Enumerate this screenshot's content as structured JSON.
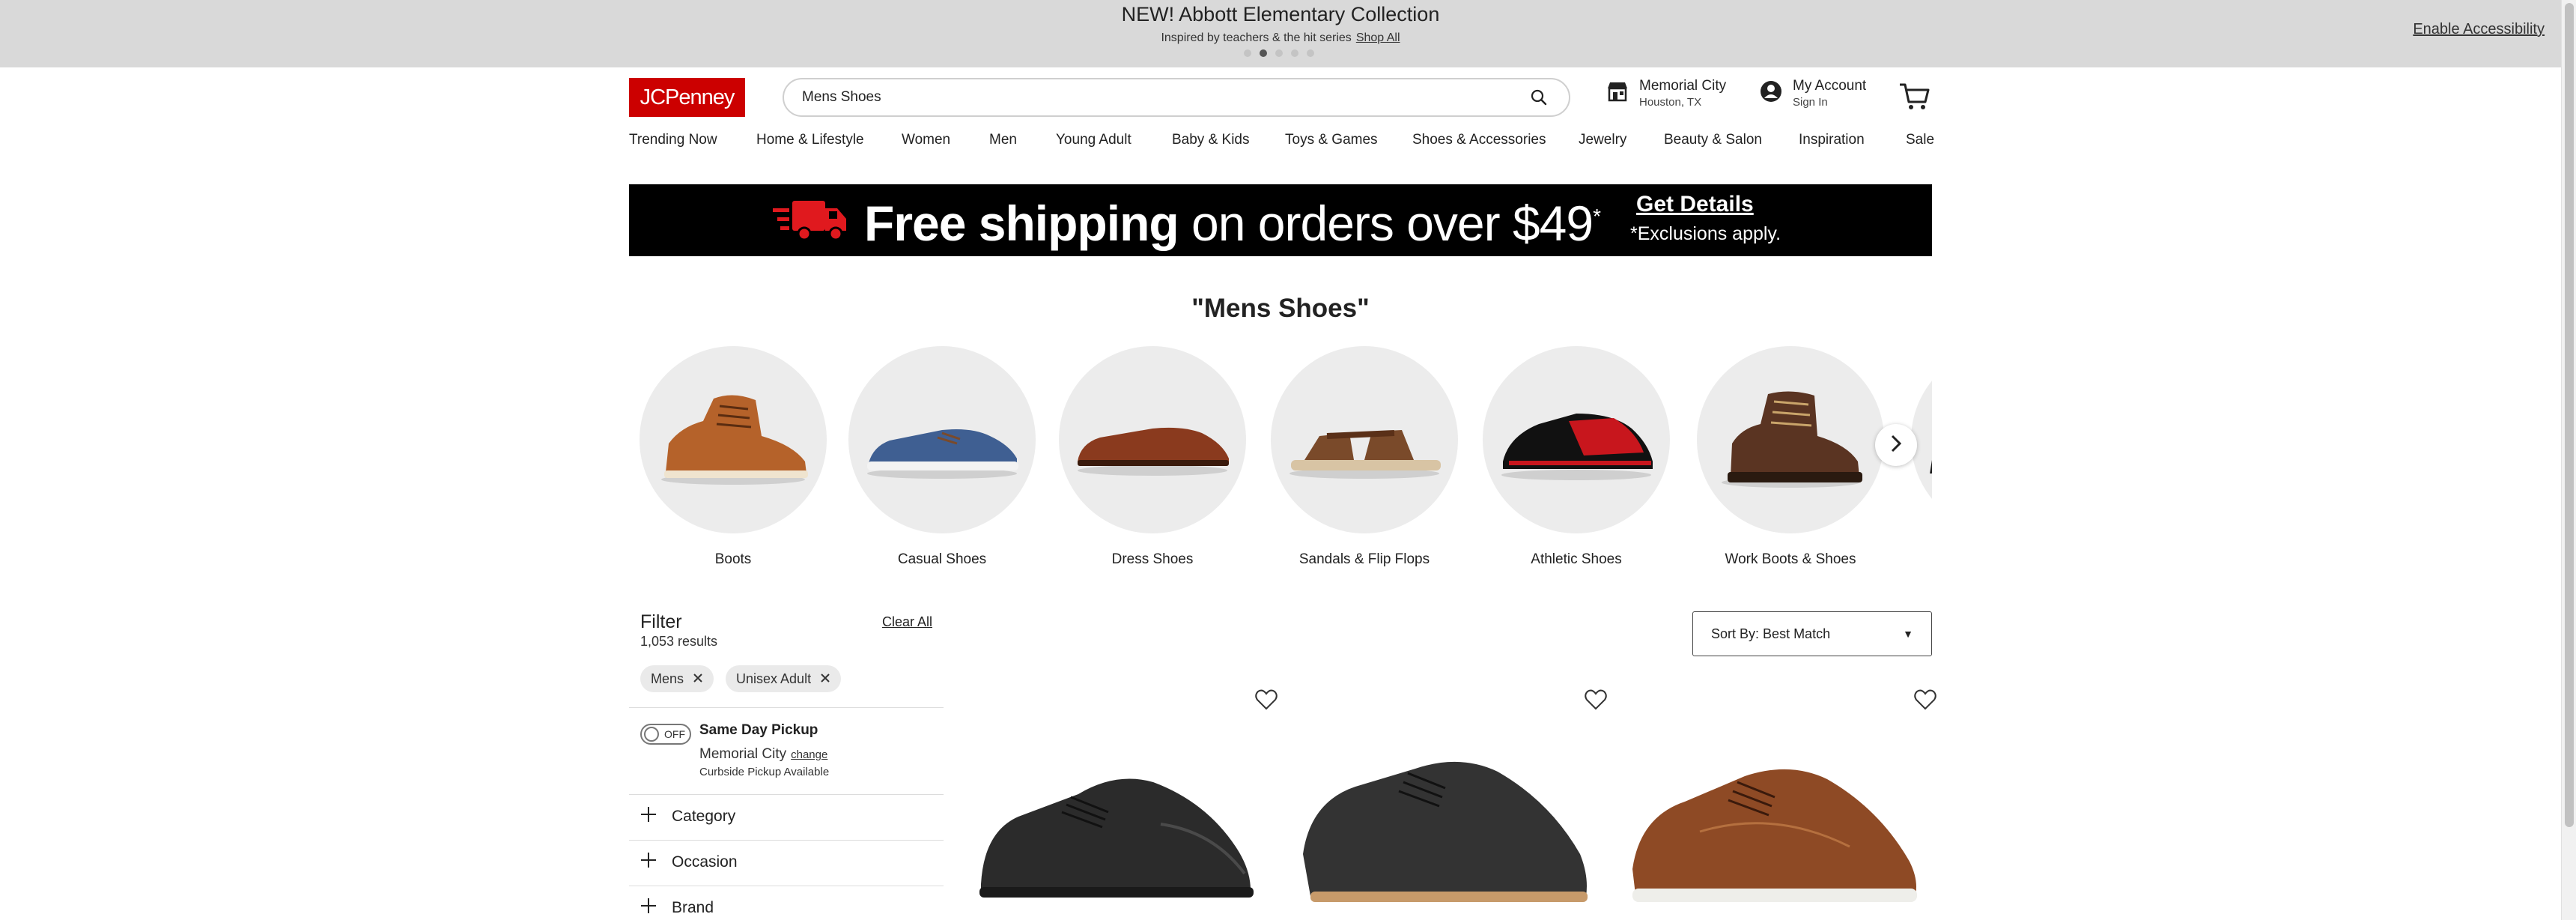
{
  "promo": {
    "title": "NEW! Abbott Elementary Collection",
    "subtitle": "Inspired by teachers & the hit series",
    "link": "Shop All",
    "slide_count": 5,
    "active_slide": 2,
    "accessibility_link": "Enable Accessibility"
  },
  "header": {
    "logo": "JCPenney",
    "search_value": "Mens Shoes",
    "store_name": "Memorial City",
    "store_location": "Houston, TX",
    "account_label": "My Account",
    "account_sub": "Sign In"
  },
  "nav": [
    "Trending Now",
    "Home & Lifestyle",
    "Women",
    "Men",
    "Young Adult",
    "Baby & Kids",
    "Toys & Games",
    "Shoes & Accessories",
    "Jewelry",
    "Beauty & Salon",
    "Inspiration",
    "Sale"
  ],
  "banner": {
    "bold": "Free shipping",
    "rest": " on orders over $49",
    "asterisk": "*",
    "cta": "Get Details",
    "note": "*Exclusions apply."
  },
  "results_title": "\"Mens Shoes\"",
  "categories": [
    {
      "label": "Boots",
      "color": "#b5622a"
    },
    {
      "label": "Casual Shoes",
      "color": "#3f5f92"
    },
    {
      "label": "Dress Shoes",
      "color": "#8a3a1e"
    },
    {
      "label": "Sandals & Flip Flops",
      "color": "#7a4a2a"
    },
    {
      "label": "Athletic Shoes",
      "color": "#c8161d"
    },
    {
      "label": "Work Boots & Shoes",
      "color": "#5a3422"
    }
  ],
  "filter": {
    "heading": "Filter",
    "count": "1,053 results",
    "clear_all": "Clear All",
    "chips": [
      "Mens",
      "Unisex Adult"
    ],
    "toggle_label": "OFF",
    "pickup_title": "Same Day Pickup",
    "pickup_store": "Memorial City",
    "change_link": "change",
    "pickup_note": "Curbside Pickup Available",
    "facets": [
      "Category",
      "Occasion",
      "Brand"
    ]
  },
  "sort": {
    "label": "Sort By:",
    "value": "Best Match"
  },
  "products": [
    {
      "color": "#2b2b2b"
    },
    {
      "color": "#333333"
    },
    {
      "color": "#8e4a25"
    }
  ],
  "colors": {
    "brand_red": "#cc0000",
    "promo_bg": "#d9d9d9",
    "banner_bg": "#000000"
  }
}
